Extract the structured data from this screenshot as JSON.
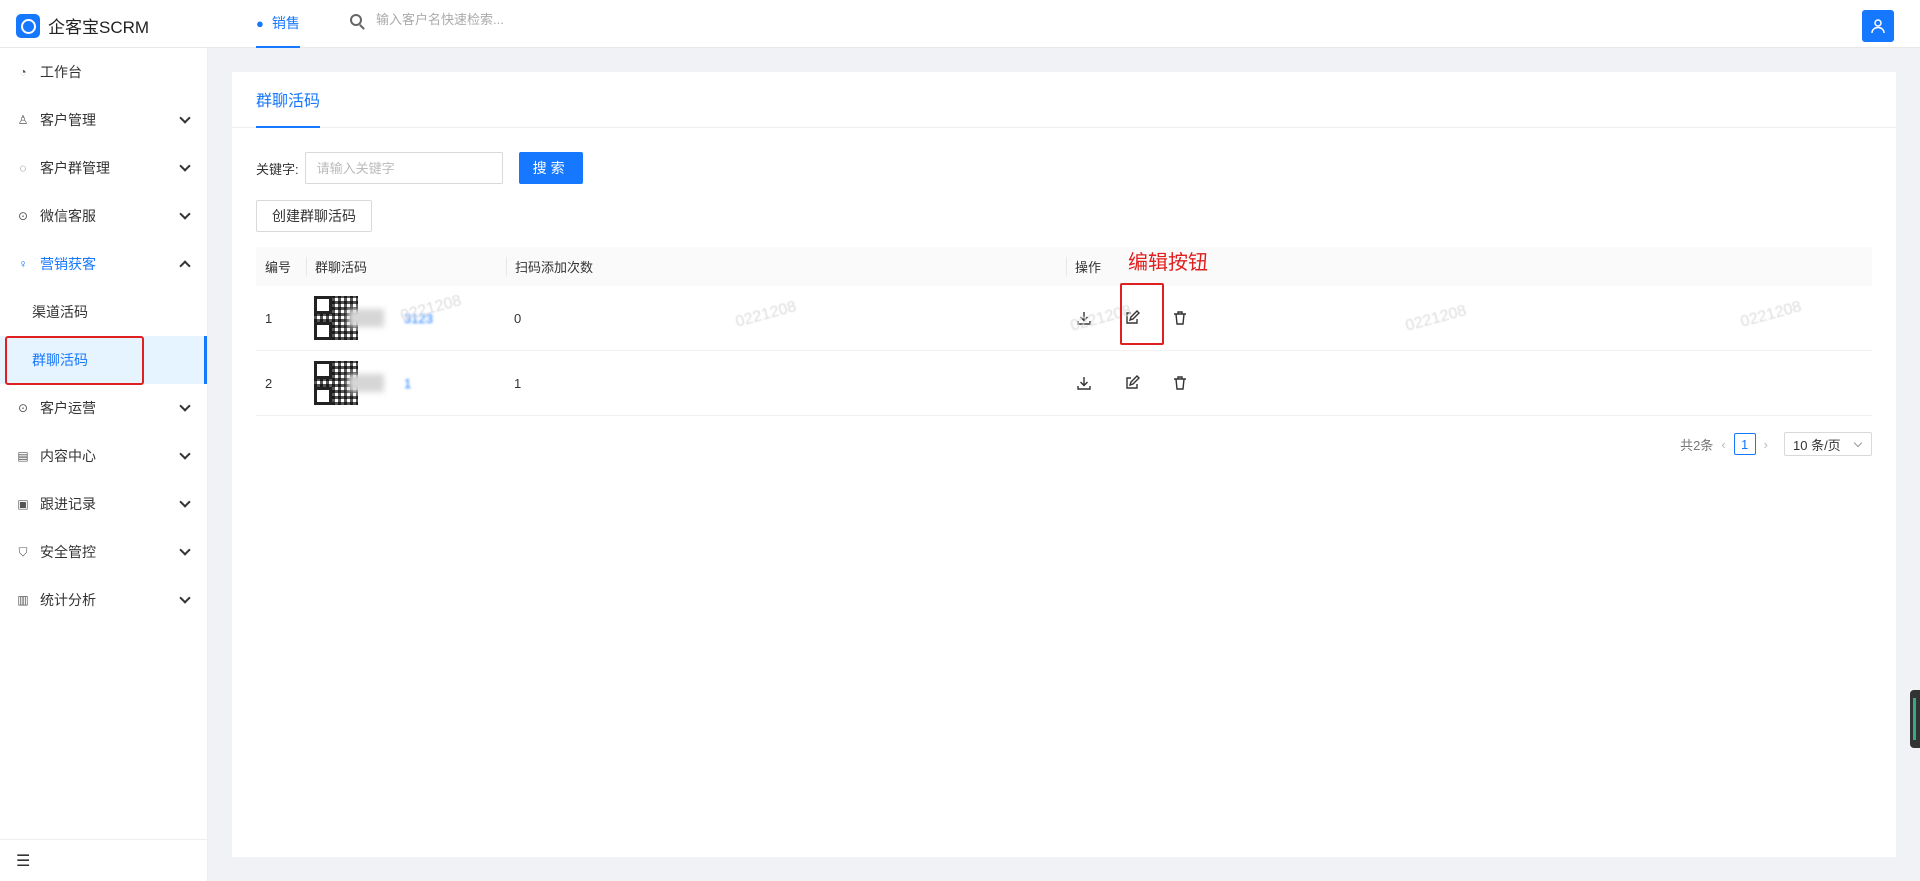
{
  "app": {
    "name": "企客宝SCRM"
  },
  "topbar": {
    "tab_label": "销售",
    "search_placeholder": "输入客户名快速检索..."
  },
  "sidebar": {
    "items": [
      {
        "label": "工作台"
      },
      {
        "label": "客户管理"
      },
      {
        "label": "客户群管理"
      },
      {
        "label": "微信客服"
      },
      {
        "label": "营销获客"
      },
      {
        "label": "客户运营"
      },
      {
        "label": "内容中心"
      },
      {
        "label": "跟进记录"
      },
      {
        "label": "安全管控"
      },
      {
        "label": "统计分析"
      }
    ],
    "sub_items": [
      {
        "label": "渠道活码"
      },
      {
        "label": "群聊活码"
      }
    ]
  },
  "main": {
    "tab_label": "群聊活码",
    "filter": {
      "label": "关键字:",
      "placeholder": "请输入关键字",
      "search_label": "搜索"
    },
    "create_label": "创建群聊活码",
    "table": {
      "headers": [
        "编号",
        "群聊活码",
        "扫码添加次数",
        "操作"
      ],
      "rows": [
        {
          "no": "1",
          "name": "3123",
          "count": "0"
        },
        {
          "no": "2",
          "name": "1",
          "count": "1"
        }
      ]
    },
    "pagination": {
      "total": "共2条",
      "page": "1",
      "page_size": "10 条/页"
    }
  },
  "annotation": {
    "text": "编辑按钮",
    "color": "#e02020"
  },
  "watermark": {
    "text": "0221208"
  },
  "colors": {
    "primary": "#1677ff",
    "annotation": "#e02020"
  }
}
